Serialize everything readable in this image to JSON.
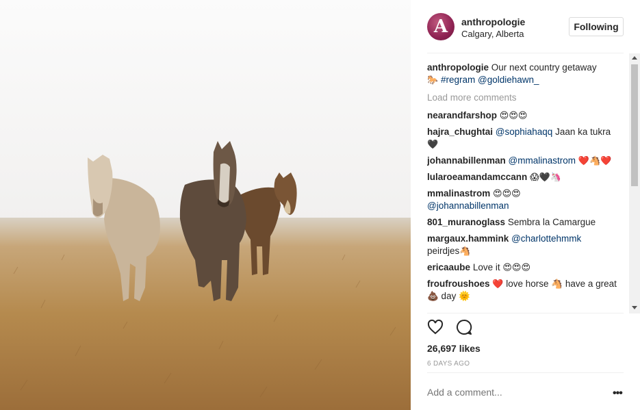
{
  "post": {
    "username": "anthropologie",
    "location": "Calgary, Alberta",
    "avatar_letter": "A",
    "follow_label": "Following",
    "caption": {
      "user": "anthropologie",
      "text": "Our next country getaway",
      "emoji": "🐎",
      "hashtag": "#regram",
      "mention": "@goldiehawn_"
    },
    "load_more": "Load more comments",
    "comments": [
      {
        "user": "nearandfarshop",
        "pre": "",
        "mention": "",
        "text": "",
        "emoji": "😍😍😍",
        "post": ""
      },
      {
        "user": "hajra_chughtai",
        "pre": "",
        "mention": "@sophiahaqq",
        "text": "Jaan ka tukra",
        "emoji": "🖤",
        "post": ""
      },
      {
        "user": "johannabillenman",
        "pre": "",
        "mention": "@mmalinastrom",
        "text": "",
        "emoji": "❤️🐴❤️",
        "post": ""
      },
      {
        "user": "lularoeamandamccann",
        "pre": "",
        "mention": "",
        "text": "",
        "emoji": "😱🖤🦄",
        "post": ""
      },
      {
        "user": "mmalinastrom",
        "pre": "",
        "mention": "",
        "text": "",
        "emoji": "😍😍😍",
        "post": "@johannabillenman"
      },
      {
        "user": "801_muranoglass",
        "pre": "",
        "mention": "",
        "text": "Sembra la Camargue",
        "emoji": "",
        "post": ""
      },
      {
        "user": "margaux.hammink",
        "pre": "",
        "mention": "@charlottehmmk",
        "text": "peirdjes",
        "emoji": "🐴",
        "post": ""
      },
      {
        "user": "ericaaube",
        "pre": "",
        "mention": "",
        "text": "Love it",
        "emoji": "😍😍😍",
        "post": ""
      },
      {
        "user": "froufroushoes",
        "pre": "❤️",
        "mention": "",
        "text": "love horse 🐴 have a great 💩 day 🌞",
        "emoji": "",
        "post": ""
      }
    ],
    "likes": "26,697 likes",
    "time_ago": "6 DAYS AGO",
    "add_comment_placeholder": "Add a comment...",
    "more_label": "•••"
  }
}
